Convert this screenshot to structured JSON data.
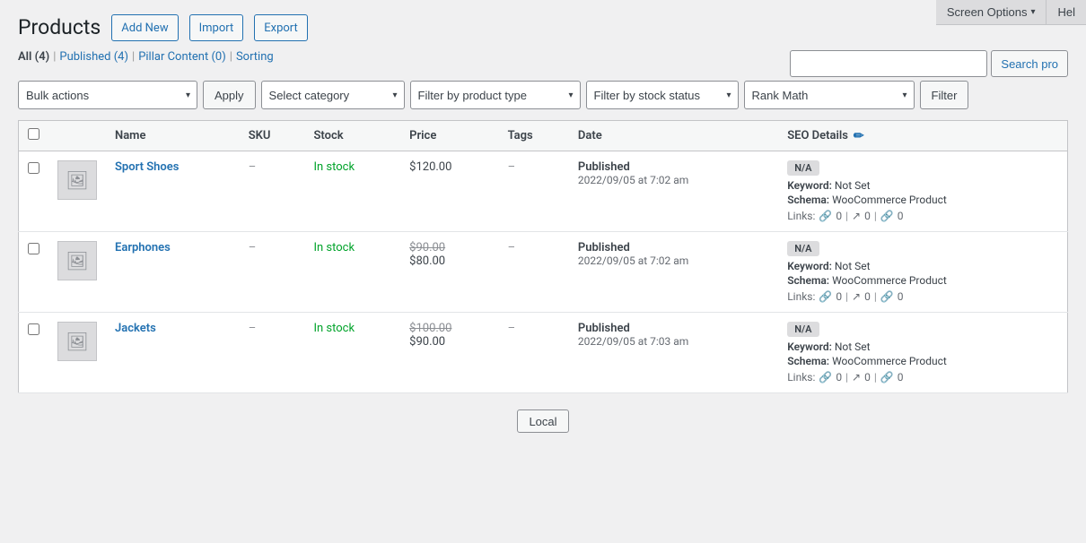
{
  "page": {
    "title": "Products",
    "screen_options": "Screen Options",
    "screen_options_arrow": "▾",
    "help": "Hel"
  },
  "header_buttons": [
    {
      "id": "add-new",
      "label": "Add New"
    },
    {
      "id": "import",
      "label": "Import"
    },
    {
      "id": "export",
      "label": "Export"
    }
  ],
  "subsubsub": {
    "all_label": "All",
    "all_count": "(4)",
    "published_label": "Published",
    "published_count": "(4)",
    "pillar_label": "Pillar Content",
    "pillar_count": "(0)",
    "sorting_label": "Sorting",
    "sep": "|"
  },
  "search": {
    "placeholder": "",
    "button_label": "Search pro"
  },
  "toolbar": {
    "bulk_actions": "Bulk actions",
    "apply": "Apply",
    "select_category": "Select category",
    "filter_product_type": "Filter by product type",
    "filter_stock_status": "Filter by stock status",
    "rank_math": "Rank Math",
    "filter_label": "Filter"
  },
  "table": {
    "columns": [
      {
        "id": "name",
        "label": "Name"
      },
      {
        "id": "sku",
        "label": "SKU"
      },
      {
        "id": "stock",
        "label": "Stock"
      },
      {
        "id": "price",
        "label": "Price"
      },
      {
        "id": "tags",
        "label": "Tags"
      },
      {
        "id": "date",
        "label": "Date"
      },
      {
        "id": "seo",
        "label": "SEO Details"
      }
    ],
    "rows": [
      {
        "id": 1,
        "name": "Sport Shoes",
        "sku": "–",
        "stock": "In stock",
        "price_original": null,
        "price_sale": "$120.00",
        "tags": "–",
        "date_status": "Published",
        "date_value": "2022/09/05 at 7:02 am",
        "seo_score": "N/A",
        "seo_keyword": "Not Set",
        "seo_schema": "WooCommerce Product",
        "seo_links_internal": "0",
        "seo_links_external": "0",
        "seo_links_affiliate": "0"
      },
      {
        "id": 2,
        "name": "Earphones",
        "sku": "–",
        "stock": "In stock",
        "price_original": "$90.00",
        "price_sale": "$80.00",
        "tags": "–",
        "date_status": "Published",
        "date_value": "2022/09/05 at 7:02 am",
        "seo_score": "N/A",
        "seo_keyword": "Not Set",
        "seo_schema": "WooCommerce Product",
        "seo_links_internal": "0",
        "seo_links_external": "0",
        "seo_links_affiliate": "0"
      },
      {
        "id": 3,
        "name": "Jackets",
        "sku": "–",
        "stock": "In stock",
        "price_original": "$100.00",
        "price_sale": "$90.00",
        "tags": "–",
        "date_status": "Published",
        "date_value": "2022/09/05 at 7:03 am",
        "seo_score": "N/A",
        "seo_keyword": "Not Set",
        "seo_schema": "WooCommerce Product",
        "seo_links_internal": "0",
        "seo_links_external": "0",
        "seo_links_affiliate": "0"
      }
    ]
  },
  "footer": {
    "local_btn": "Local"
  },
  "labels": {
    "keyword_prefix": "Keyword: ",
    "schema_prefix": "Schema: ",
    "links_prefix": "Links: ",
    "pipe": "|"
  }
}
